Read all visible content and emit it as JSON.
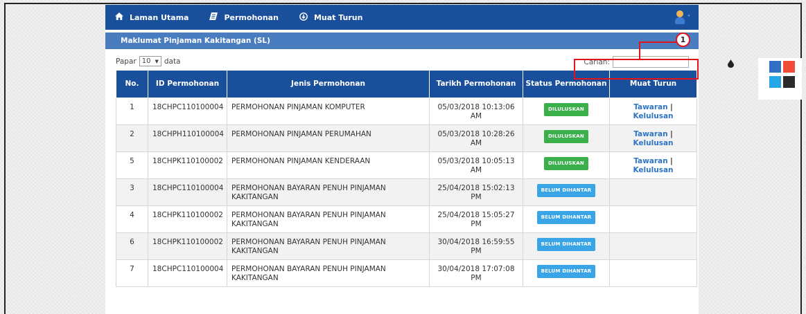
{
  "nav": {
    "items": [
      {
        "label": "Laman Utama",
        "icon": "home-icon"
      },
      {
        "label": "Permohonan",
        "icon": "document-icon"
      },
      {
        "label": "Muat Turun",
        "icon": "download-icon"
      }
    ],
    "user_caret": "˅"
  },
  "panel": {
    "title": "Maklumat Pinjaman Kakitangan (SL)"
  },
  "controls": {
    "show_prefix": "Papar",
    "show_value": "10",
    "show_suffix": "data",
    "search_label": "Carian:",
    "search_value": ""
  },
  "table": {
    "headers": [
      "No.",
      "ID Permohonan",
      "Jenis Permohonan",
      "Tarikh Permohonan",
      "Status Permohonan",
      "Muat Turun"
    ],
    "rows": [
      {
        "no": "1",
        "id": "18CHPC110100004",
        "jenis": "PERMOHONAN PINJAMAN KOMPUTER",
        "tarikh": "05/03/2018 10:13:06 AM",
        "status": "DILULUSKAN",
        "status_type": "green",
        "link1": "Tawaran",
        "link2": "Kelulusan"
      },
      {
        "no": "2",
        "id": "18CHPH110100004",
        "jenis": "PERMOHONAN PINJAMAN PERUMAHAN",
        "tarikh": "05/03/2018 10:28:26 AM",
        "status": "DILULUSKAN",
        "status_type": "green",
        "link1": "Tawaran",
        "link2": "Kelulusan"
      },
      {
        "no": "5",
        "id": "18CHPK110100002",
        "jenis": "PERMOHONAN PINJAMAN KENDERAAN",
        "tarikh": "05/03/2018 10:05:13 AM",
        "status": "DILULUSKAN",
        "status_type": "green",
        "link1": "Tawaran",
        "link2": "Kelulusan"
      },
      {
        "no": "3",
        "id": "18CHPC110100004",
        "jenis": "PERMOHONAN BAYARAN PENUH PINJAMAN KAKITANGAN",
        "tarikh": "25/04/2018 15:02:13 PM",
        "status": "BELUM DIHANTAR",
        "status_type": "blue",
        "link1": "",
        "link2": ""
      },
      {
        "no": "4",
        "id": "18CHPK110100002",
        "jenis": "PERMOHONAN BAYARAN PENUH PINJAMAN KAKITANGAN",
        "tarikh": "25/04/2018 15:05:27 PM",
        "status": "BELUM DIHANTAR",
        "status_type": "blue",
        "link1": "",
        "link2": ""
      },
      {
        "no": "6",
        "id": "18CHPK110100002",
        "jenis": "PERMOHONAN BAYARAN PENUH PINJAMAN KAKITANGAN",
        "tarikh": "30/04/2018 16:59:55 PM",
        "status": "BELUM DIHANTAR",
        "status_type": "blue",
        "link1": "",
        "link2": ""
      },
      {
        "no": "7",
        "id": "18CHPC110100004",
        "jenis": "PERMOHONAN BAYARAN PENUH PINJAMAN KAKITANGAN",
        "tarikh": "30/04/2018 17:07:08 PM",
        "status": "BELUM DIHANTAR",
        "status_type": "blue",
        "link1": "",
        "link2": ""
      }
    ]
  },
  "annotation": {
    "number": "1"
  },
  "theme": {
    "icon": "drop-icon",
    "swatches": [
      "#2f6fc4",
      "#f04a38",
      "#25a7e8",
      "#2b2b2b"
    ]
  },
  "colors": {
    "nav": "#1a4f9c",
    "panel_header": "#4a7cc0",
    "approved": "#3bb04a",
    "pending": "#3aa5e6",
    "annotation": "#e3121b",
    "link": "#2d74c4"
  }
}
